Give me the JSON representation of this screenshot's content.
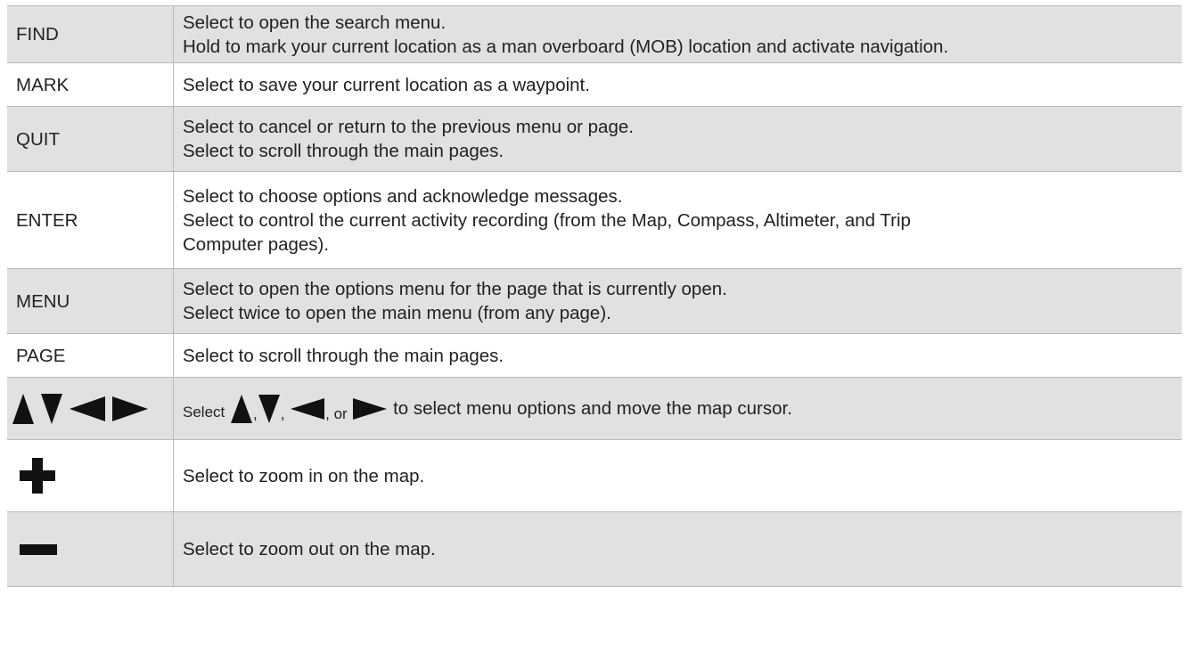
{
  "rows": [
    {
      "key": "FIND",
      "lines": [
        "Select to open the search menu.",
        "Hold to mark your current location as a man overboard (MOB) location and activate navigation."
      ]
    },
    {
      "key": "MARK",
      "lines": [
        "Select to save your current location as a waypoint."
      ]
    },
    {
      "key": "QUIT",
      "lines": [
        "Select to cancel or return to the previous menu or page.",
        "Select to scroll through the main pages."
      ]
    },
    {
      "key": "ENTER",
      "lines": [
        "Select to choose options and acknowledge messages.",
        "Select to control the current activity recording (from the Map, Compass, Altimeter, and Trip",
        "Computer pages)."
      ]
    },
    {
      "key": "MENU",
      "lines": [
        "Select to open the options menu for the page that is currently open.",
        "Select twice to open the main menu (from any page)."
      ]
    },
    {
      "key": "PAGE",
      "lines": [
        "Select to scroll through the main pages."
      ]
    }
  ],
  "arrows_row": {
    "key_icons": [
      "up-arrow-icon",
      "down-arrow-icon",
      "left-arrow-icon",
      "right-arrow-icon"
    ],
    "text_select": "Select",
    "text_comma": ",",
    "text_or": ", or",
    "text_rest": " to select menu options and move the map cursor."
  },
  "plus_row": {
    "key_icon": "plus-icon",
    "text": "Select to zoom in on the map."
  },
  "minus_row": {
    "key_icon": "minus-icon",
    "text": "Select to zoom out on the map."
  },
  "colors": {
    "shaded": "#e1e1e1",
    "border": "#b9b9b9",
    "text": "#222222",
    "icon": "#111111"
  }
}
